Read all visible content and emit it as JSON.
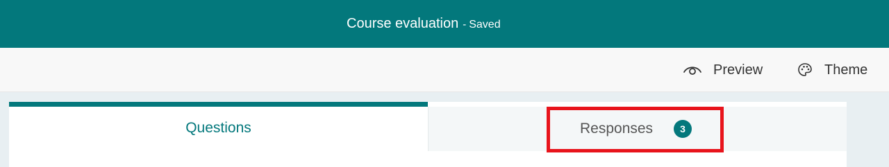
{
  "header": {
    "title": "Course evaluation",
    "separator": "-",
    "status": "Saved"
  },
  "toolbar": {
    "preview_label": "Preview",
    "preview_icon": "eye-icon",
    "theme_label": "Theme",
    "theme_icon": "palette-icon"
  },
  "tabs": [
    {
      "label": "Questions",
      "active": true
    },
    {
      "label": "Responses",
      "active": false,
      "badge": "3"
    }
  ],
  "colors": {
    "brand": "#03787c",
    "highlight": "#e8141c"
  }
}
